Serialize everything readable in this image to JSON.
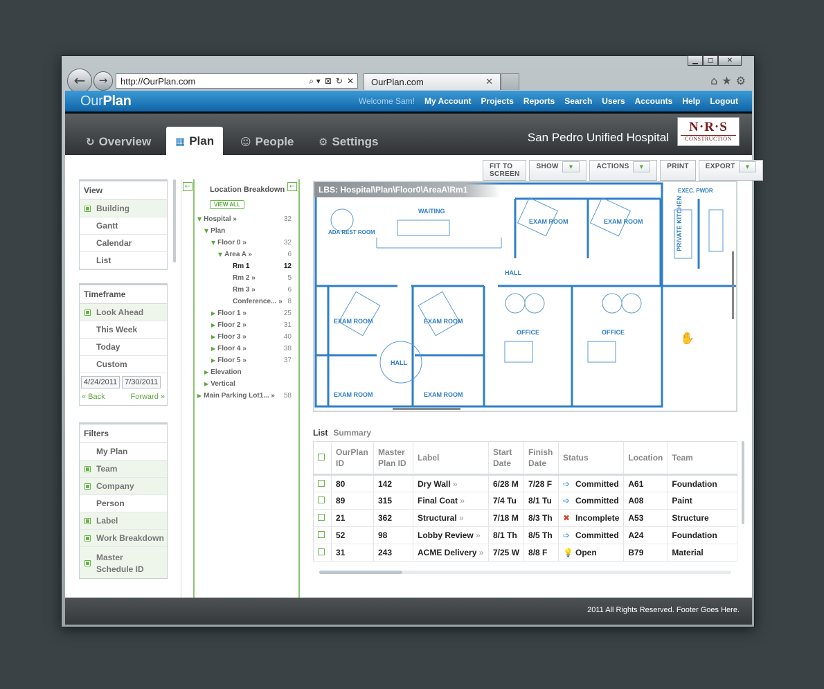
{
  "browser": {
    "url": "http://OurPlan.com",
    "tab_title": "OurPlan.com",
    "win_controls": [
      "▁",
      "◻",
      "✕"
    ],
    "tab_close": "✕",
    "addr_icons": [
      "⌕ ▾",
      "⊠",
      "↻",
      "✕"
    ],
    "tool_icons": [
      "⌂",
      "★",
      "⚙"
    ]
  },
  "app": {
    "logo_light": "Our",
    "logo_bold": "Plan",
    "welcome": "Welcome Sam!",
    "nav": [
      "My Account",
      "Projects",
      "Reports",
      "Search",
      "Users",
      "Accounts",
      "Help",
      "Logout"
    ],
    "tabs": [
      {
        "label": "Overview",
        "icon": "↻"
      },
      {
        "label": "Plan",
        "icon": "▦"
      },
      {
        "label": "People",
        "icon": "☺"
      },
      {
        "label": "Settings",
        "icon": "⚙"
      }
    ],
    "project_name": "San Pedro Unified Hospital",
    "company_logo": {
      "name": "N·R·S",
      "sub": "CONSTRUCTION"
    }
  },
  "view": {
    "header": "View",
    "items": [
      {
        "label": "Building",
        "on": true
      },
      {
        "label": "Gantt"
      },
      {
        "label": "Calendar"
      },
      {
        "label": "List"
      }
    ]
  },
  "timeframe": {
    "header": "Timeframe",
    "items": [
      {
        "label": "Look Ahead",
        "on": true
      },
      {
        "label": "This Week"
      },
      {
        "label": "Today"
      },
      {
        "label": "Custom"
      }
    ],
    "start": "4/24/2011",
    "end": "7/30/2011",
    "back": "« Back",
    "forward": "Forward »"
  },
  "filters": {
    "header": "Filters",
    "items": [
      {
        "label": "My Plan"
      },
      {
        "label": "Team",
        "on": true
      },
      {
        "label": "Company",
        "on": true
      },
      {
        "label": "Person"
      },
      {
        "label": "Label",
        "on": true
      },
      {
        "label": "Work Breakdown",
        "on": true
      },
      {
        "label": "Master Schedule ID",
        "on": true
      }
    ]
  },
  "tree": {
    "title": "Location Breakdown",
    "view_all": "VIEW ALL",
    "collapse": "←",
    "nodes": [
      {
        "label": "Hospital »",
        "count": "32",
        "indent": 0,
        "toggle": "▼"
      },
      {
        "label": "Plan",
        "count": "",
        "indent": 1,
        "toggle": "▼"
      },
      {
        "label": "Floor 0 »",
        "count": "32",
        "indent": 2,
        "toggle": "▼"
      },
      {
        "label": "Area A »",
        "count": "6",
        "indent": 3,
        "toggle": "▼"
      },
      {
        "label": "Rm 1",
        "count": "12",
        "indent": 4,
        "toggle": "",
        "sel": true
      },
      {
        "label": "Rm 2 »",
        "count": "5",
        "indent": 4,
        "toggle": ""
      },
      {
        "label": "Rm 3 »",
        "count": "6",
        "indent": 4,
        "toggle": ""
      },
      {
        "label": "Conference... »",
        "count": "8",
        "indent": 4,
        "toggle": ""
      },
      {
        "label": "Floor 1 »",
        "count": "25",
        "indent": 2,
        "toggle": "▶"
      },
      {
        "label": "Floor 2 »",
        "count": "31",
        "indent": 2,
        "toggle": "▶"
      },
      {
        "label": "Floor 3 »",
        "count": "40",
        "indent": 2,
        "toggle": "▶"
      },
      {
        "label": "Floor 4 »",
        "count": "38",
        "indent": 2,
        "toggle": "▶"
      },
      {
        "label": "Floor 5 »",
        "count": "37",
        "indent": 2,
        "toggle": "▶"
      },
      {
        "label": "Elevation",
        "count": "",
        "indent": 1,
        "toggle": "▶"
      },
      {
        "label": "Vertical",
        "count": "",
        "indent": 1,
        "toggle": "▶"
      },
      {
        "label": "Main Parking Lot1... »",
        "count": "58",
        "indent": 0,
        "toggle": "▶"
      }
    ]
  },
  "toolbar": [
    {
      "label": "FIT TO SCREEN"
    },
    {
      "label": "SHOW",
      "dd": "▼"
    },
    {
      "label": "ACTIONS",
      "dd": "▼"
    },
    {
      "label": "PRINT"
    },
    {
      "label": "EXPORT",
      "dd": "▼"
    }
  ],
  "plan": {
    "path": "LBS: Hospital\\Plan\\Floor0\\AreaA\\Rm1",
    "cursor": "✋",
    "rooms": [
      "WAITING",
      "ADA REST ROOM",
      "EXAM ROOM",
      "EXAM ROOM",
      "HALL",
      "EXAM ROOM",
      "EXAM ROOM",
      "OFFICE",
      "OFFICE",
      "HALL",
      "EXAM ROOM",
      "EXAM ROOM",
      "PRIVATE KITCHEN",
      "EXEC. PWDR"
    ]
  },
  "list": {
    "tabs": [
      "List",
      "Summary"
    ],
    "columns": [
      "",
      "OurPlan ID",
      "Master Plan ID",
      "Label",
      "Start Date",
      "Finish Date",
      "Status",
      "Location",
      "Team"
    ],
    "rows": [
      {
        "id": "80",
        "master": "142",
        "label": "Dry Wall",
        "start": "6/28 M",
        "finish": "7/28 F",
        "status": "Committed",
        "status_icon": "➩",
        "status_color": "#2a8fd0",
        "location": "A61",
        "team": "Foundation"
      },
      {
        "id": "89",
        "master": "315",
        "label": "Final Coat",
        "start": "7/4 Tu",
        "finish": "8/1 Tu",
        "status": "Committed",
        "status_icon": "➩",
        "status_color": "#2a8fd0",
        "location": "A08",
        "team": "Paint"
      },
      {
        "id": "21",
        "master": "362",
        "label": "Structural",
        "start": "7/18 M",
        "finish": "8/3 Th",
        "status": "Incomplete",
        "status_icon": "✖",
        "status_color": "#d24a3a",
        "location": "A53",
        "team": "Structure"
      },
      {
        "id": "52",
        "master": "98",
        "label": "Lobby Review",
        "start": "8/1 Th",
        "finish": "8/5 Th",
        "status": "Committed",
        "status_icon": "➩",
        "status_color": "#2a8fd0",
        "location": "A24",
        "team": "Foundation"
      },
      {
        "id": "31",
        "master": "243",
        "label": "ACME Delivery",
        "start": "7/25 W",
        "finish": "8/8 F",
        "status": "Open",
        "status_icon": "💡",
        "status_color": "#e0a020",
        "location": "B79",
        "team": "Material"
      }
    ]
  },
  "footer": "2011 All Rights Reserved. Footer Goes Here."
}
